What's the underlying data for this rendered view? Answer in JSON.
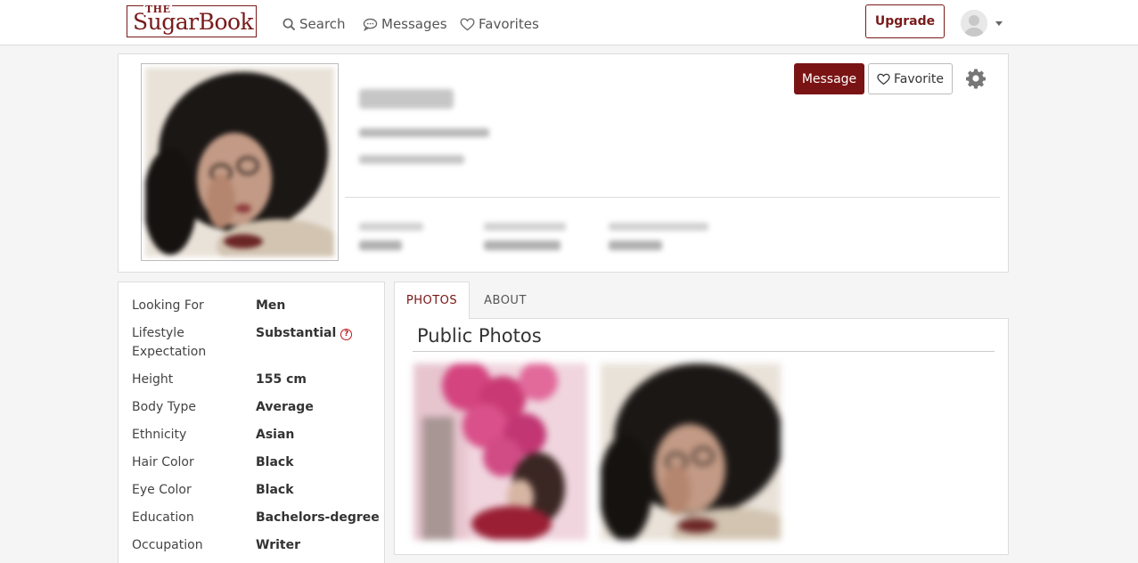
{
  "brand": {
    "logo_top": "THE",
    "logo_name": "SugarBook",
    "accent": "#7a1313"
  },
  "nav": {
    "items": [
      {
        "label": "Search",
        "icon": "search-icon"
      },
      {
        "label": "Messages",
        "icon": "chat-bubble-icon"
      },
      {
        "label": "Favorites",
        "icon": "heart-icon"
      }
    ],
    "upgrade_label": "Upgrade"
  },
  "profile": {
    "actions": {
      "message_label": "Message",
      "favorite_label": "Favorite"
    }
  },
  "details": [
    {
      "label": "Looking For",
      "value": "Men"
    },
    {
      "label": "Lifestyle Expectation",
      "value": "Substantial",
      "help": "?"
    },
    {
      "label": "Height",
      "value": "155 cm"
    },
    {
      "label": "Body Type",
      "value": "Average"
    },
    {
      "label": "Ethnicity",
      "value": "Asian"
    },
    {
      "label": "Hair Color",
      "value": "Black"
    },
    {
      "label": "Eye Color",
      "value": "Black"
    },
    {
      "label": "Education",
      "value": "Bachelors-degree"
    },
    {
      "label": "Occupation",
      "value": "Writer"
    }
  ],
  "tabs": [
    {
      "label": "PHOTOS",
      "active": true
    },
    {
      "label": "ABOUT",
      "active": false
    }
  ],
  "photos_section": {
    "title": "Public Photos"
  }
}
